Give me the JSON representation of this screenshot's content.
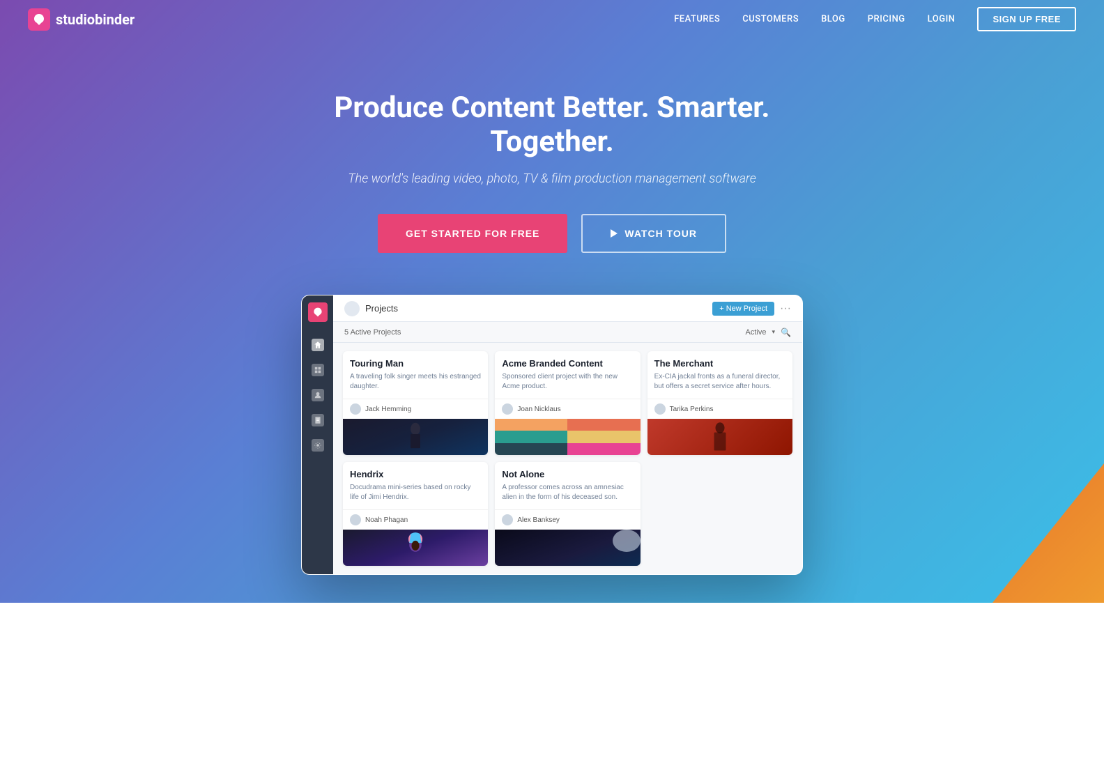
{
  "nav": {
    "logo_text_part1": "studio",
    "logo_text_part2": "binder",
    "links": [
      {
        "label": "FEATURES",
        "id": "nav-features"
      },
      {
        "label": "CUSTOMERS",
        "id": "nav-customers"
      },
      {
        "label": "BLOG",
        "id": "nav-blog"
      },
      {
        "label": "PRICING",
        "id": "nav-pricing"
      },
      {
        "label": "LOGIN",
        "id": "nav-login"
      }
    ],
    "cta_label": "SIGN UP FREE"
  },
  "hero": {
    "title": "Produce Content Better. Smarter. Together.",
    "subtitle": "The world's leading video, photo, TV & film production management software",
    "btn_primary": "GET STARTED FOR FREE",
    "btn_secondary": "WATCH TOUR"
  },
  "app": {
    "topbar_title": "Projects",
    "new_project_btn": "+ New Project",
    "active_projects": "5 Active Projects",
    "active_label": "Active",
    "projects": [
      {
        "id": "touring-man",
        "title": "Touring Man",
        "desc": "A traveling folk singer meets his estranged daughter.",
        "author": "Jack Hemming",
        "image_type": "dark-portrait"
      },
      {
        "id": "acme",
        "title": "Acme Branded Content",
        "desc": "Sponsored client project with the new Acme product.",
        "author": "Joan Nicklaus",
        "image_type": "grid-color"
      },
      {
        "id": "merchant",
        "title": "The Merchant",
        "desc": "Ex-CIA jackal fronts as a funeral director, but offers a secret service after hours.",
        "author": "Tarika Perkins",
        "image_type": "red-portrait"
      },
      {
        "id": "hendrix",
        "title": "Hendrix",
        "desc": "Docudrama mini-series based on rocky life of Jimi Hendrix.",
        "author": "Noah Phagan",
        "image_type": "colorful-portrait"
      },
      {
        "id": "not-alone",
        "title": "Not Alone",
        "desc": "A professor comes across an amnesiac alien in the form of his deceased son.",
        "author": "Alex Banksey",
        "image_type": "space"
      }
    ]
  }
}
